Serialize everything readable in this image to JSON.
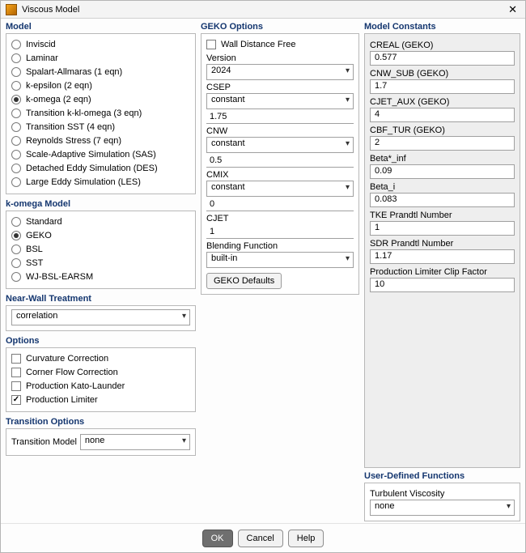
{
  "window": {
    "title": "Viscous Model"
  },
  "model": {
    "heading": "Model",
    "items": [
      {
        "label": "Inviscid",
        "selected": false
      },
      {
        "label": "Laminar",
        "selected": false
      },
      {
        "label": "Spalart-Allmaras (1 eqn)",
        "selected": false
      },
      {
        "label": "k-epsilon (2 eqn)",
        "selected": false
      },
      {
        "label": "k-omega (2 eqn)",
        "selected": true
      },
      {
        "label": "Transition k-kl-omega (3 eqn)",
        "selected": false
      },
      {
        "label": "Transition SST (4 eqn)",
        "selected": false
      },
      {
        "label": "Reynolds Stress (7 eqn)",
        "selected": false
      },
      {
        "label": "Scale-Adaptive Simulation (SAS)",
        "selected": false
      },
      {
        "label": "Detached Eddy Simulation (DES)",
        "selected": false
      },
      {
        "label": "Large Eddy Simulation (LES)",
        "selected": false
      }
    ]
  },
  "komega": {
    "heading": "k-omega Model",
    "items": [
      {
        "label": "Standard",
        "selected": false
      },
      {
        "label": "GEKO",
        "selected": true
      },
      {
        "label": "BSL",
        "selected": false
      },
      {
        "label": "SST",
        "selected": false
      },
      {
        "label": "WJ-BSL-EARSM",
        "selected": false
      }
    ]
  },
  "nearwall": {
    "heading": "Near-Wall Treatment",
    "value": "correlation"
  },
  "options": {
    "heading": "Options",
    "items": [
      {
        "label": "Curvature Correction",
        "checked": false
      },
      {
        "label": "Corner Flow Correction",
        "checked": false
      },
      {
        "label": "Production Kato-Launder",
        "checked": false
      },
      {
        "label": "Production Limiter",
        "checked": true
      }
    ]
  },
  "transition": {
    "heading": "Transition Options",
    "label": "Transition Model",
    "value": "none"
  },
  "geko": {
    "heading": "GEKO Options",
    "wdf_label": "Wall Distance Free",
    "wdf_checked": false,
    "version_label": "Version",
    "version_value": "2024",
    "csep_label": "CSEP",
    "csep_mode": "constant",
    "csep_value": "1.75",
    "cnw_label": "CNW",
    "cnw_mode": "constant",
    "cnw_value": "0.5",
    "cmix_label": "CMIX",
    "cmix_mode": "constant",
    "cmix_value": "0",
    "cjet_label": "CJET",
    "cjet_value": "1",
    "blend_label": "Blending Function",
    "blend_value": "built-in",
    "defaults_button": "GEKO Defaults"
  },
  "constants": {
    "heading": "Model Constants",
    "items": [
      {
        "label": "CREAL (GEKO)",
        "value": "0.577"
      },
      {
        "label": "CNW_SUB (GEKO)",
        "value": "1.7"
      },
      {
        "label": "CJET_AUX (GEKO)",
        "value": "4"
      },
      {
        "label": "CBF_TUR (GEKO)",
        "value": "2"
      },
      {
        "label": "Beta*_inf",
        "value": "0.09"
      },
      {
        "label": "Beta_i",
        "value": "0.083"
      },
      {
        "label": "TKE Prandtl Number",
        "value": "1"
      },
      {
        "label": "SDR Prandtl Number",
        "value": "1.17"
      },
      {
        "label": "Production Limiter Clip Factor",
        "value": "10"
      }
    ]
  },
  "udf": {
    "heading": "User-Defined Functions",
    "label": "Turbulent Viscosity",
    "value": "none"
  },
  "footer": {
    "ok": "OK",
    "cancel": "Cancel",
    "help": "Help"
  }
}
